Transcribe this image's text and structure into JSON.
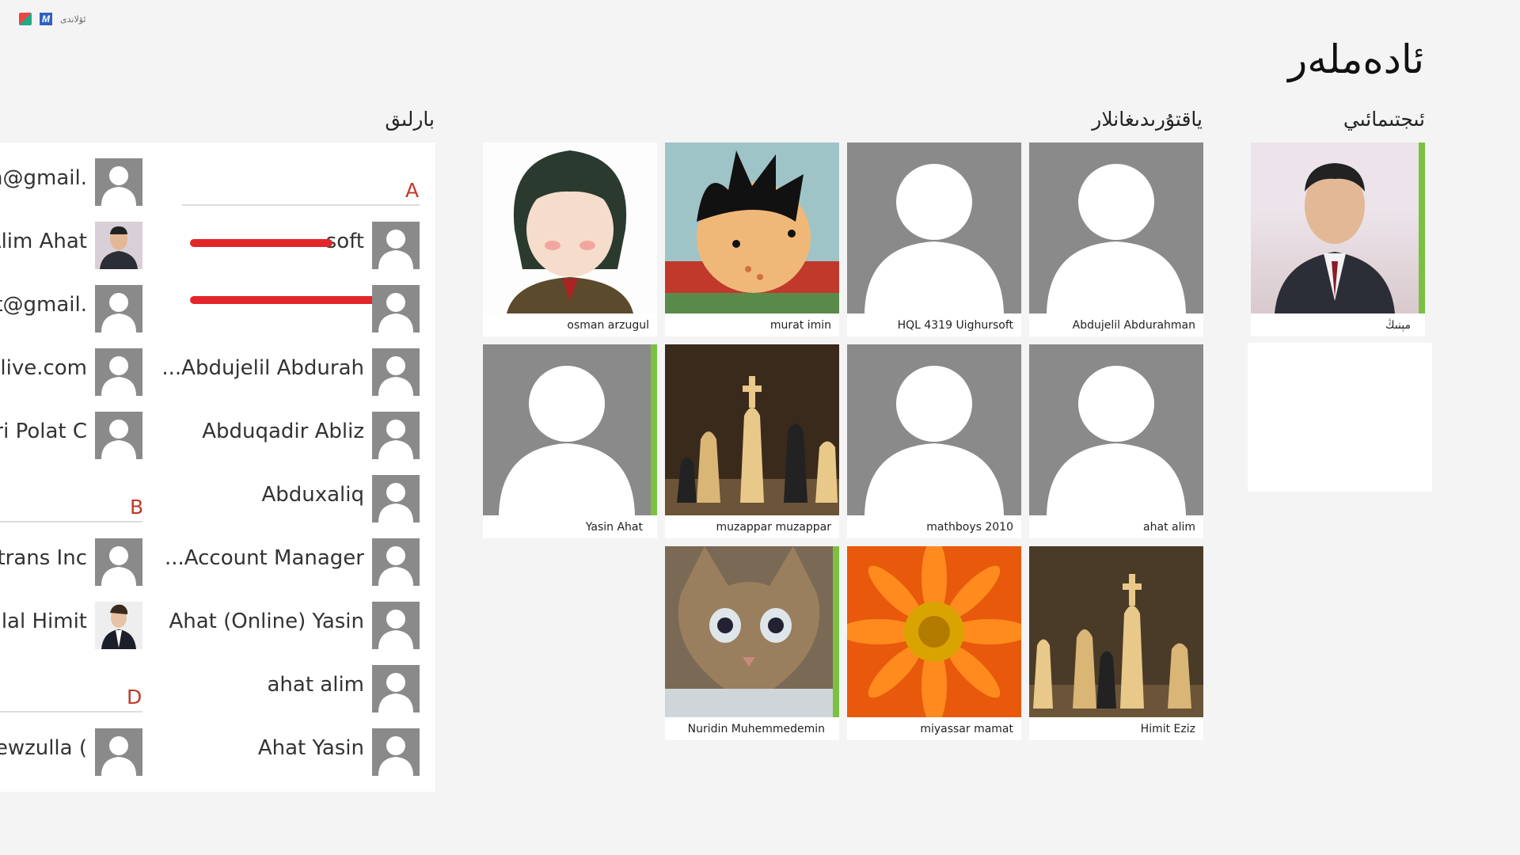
{
  "topbar": {
    "label": "ئۆلاندى"
  },
  "page_title": "ئادەملەر",
  "sections": {
    "social": "ئىجتىمائىي",
    "favorites": "ياقتۇرىدىغانلار",
    "all": "بارلىق"
  },
  "me": {
    "name": "مېنىڭ"
  },
  "favorites": [
    {
      "name": "osman arzugul"
    },
    {
      "name": "murat imin"
    },
    {
      "name": "HQL 4319 Uighursoft"
    },
    {
      "name": "Abdujelil Abdurahman"
    },
    {
      "name": "Yasin Ahat"
    },
    {
      "name": "muzappar muzappar"
    },
    {
      "name": "mathboys 2010"
    },
    {
      "name": "ahat alim"
    },
    {
      "name": "Nuridin Muhemmedemin"
    },
    {
      "name": "miyassar mamat"
    },
    {
      "name": "Himit Eziz"
    }
  ],
  "all": {
    "letters": [
      "A",
      "B",
      "D"
    ],
    "right_column": [
      "soft",
      "",
      "...Abdujelil Abdurah",
      "Abduqadir Abliz",
      "Abduxaliq",
      "...Account Manager",
      "Ahat (Online) Yasin",
      "ahat alim",
      "Ahat Yasin"
    ],
    "left_column": [
      "sh@gmail.",
      "Alim Ahat",
      "at@gmail.",
      "@live.com",
      "uri Polat C",
      "dtrans Inc",
      "Bilal Himit",
      "Hewzulla ("
    ]
  },
  "colors": {
    "accent_green": "#7ac142",
    "letter_red": "#c0392b",
    "placeholder_gray": "#8a8a8a"
  }
}
